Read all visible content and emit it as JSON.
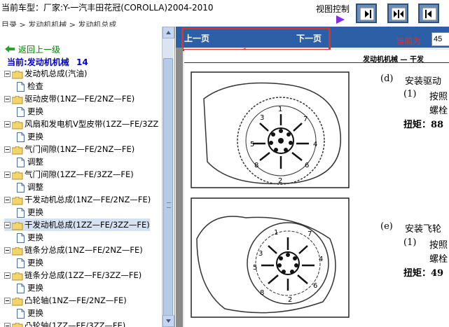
{
  "header": {
    "title": "当前车型：厂家:Y-一汽丰田花冠(COROLLA)2004-2010",
    "subtitle": "目录 > 发动机机械 > 发动机总成",
    "view_control_label": "视图控制"
  },
  "colors": {
    "nav_blue": "#2b5fa6",
    "highlight_red": "#e0302a",
    "link_green": "#008000",
    "current_blue": "#0000cc",
    "folder_yellow": "#f2d66b"
  },
  "sidebar": {
    "back_label": "返回上一级",
    "current_label": "当前:发动机机械",
    "current_count": "14",
    "items": [
      {
        "type": "folder",
        "label": "发动机总成(汽油)"
      },
      {
        "type": "doc",
        "label": "检查"
      },
      {
        "type": "folder",
        "label": "驱动皮带(1NZ—FE/2NZ—FE)"
      },
      {
        "type": "doc",
        "label": "更换"
      },
      {
        "type": "folder",
        "label": "风扇和发电机V型皮带(1ZZ—FE/3ZZ"
      },
      {
        "type": "doc",
        "label": "更换"
      },
      {
        "type": "folder",
        "label": "气门间隙(1NZ—FE/2NZ—FE)"
      },
      {
        "type": "doc",
        "label": "调整"
      },
      {
        "type": "folder",
        "label": "气门间隙(1ZZ—FE/3ZZ—FE)"
      },
      {
        "type": "doc",
        "label": "调整"
      },
      {
        "type": "folder",
        "label": "干发动机总成(1NZ—FE/2NZ—FE)"
      },
      {
        "type": "doc",
        "label": "更换"
      },
      {
        "type": "folder",
        "label": "干发动机总成(1ZZ—FE/3ZZ—FE)"
      },
      {
        "type": "doc",
        "label": "更换"
      },
      {
        "type": "folder",
        "label": "链条分总成(1NZ—FE/2NZ—FE)"
      },
      {
        "type": "doc",
        "label": "更换"
      },
      {
        "type": "folder",
        "label": "链条分总成(1ZZ—FE/3ZZ—FE)"
      },
      {
        "type": "doc",
        "label": "更换"
      },
      {
        "type": "folder",
        "label": "凸轮轴(1NZ—FE/2NZ—FE)"
      },
      {
        "type": "doc",
        "label": "更换"
      },
      {
        "type": "folder",
        "label": "凸轮轴(1ZZ—FE/3ZZ—FE)"
      }
    ]
  },
  "nav": {
    "prev_label": "上一页",
    "next_label": "下一页",
    "current_page_label": "当前为",
    "current_page_value": "45"
  },
  "document": {
    "header": "发动机机械  —  干发",
    "step_d": "(d)",
    "step_d_text": "安装驱动",
    "step_d_sub": "(1)",
    "step_d_sub_text": "按照",
    "step_d_sub_text2": "螺栓",
    "step_d_torque": "扭矩：88",
    "step_e": "(e)",
    "step_e_text": "安装飞轮",
    "step_e_sub": "(1)",
    "step_e_sub_text": "按照",
    "step_e_sub_text2": "螺栓",
    "step_e_torque": "扭矩：49",
    "fig1_numbers": [
      "1",
      "2",
      "3",
      "4",
      "5",
      "6",
      "7",
      "8"
    ],
    "fig2_numbers": [
      "1",
      "2",
      "3",
      "4",
      "5",
      "6",
      "7",
      "8"
    ]
  }
}
